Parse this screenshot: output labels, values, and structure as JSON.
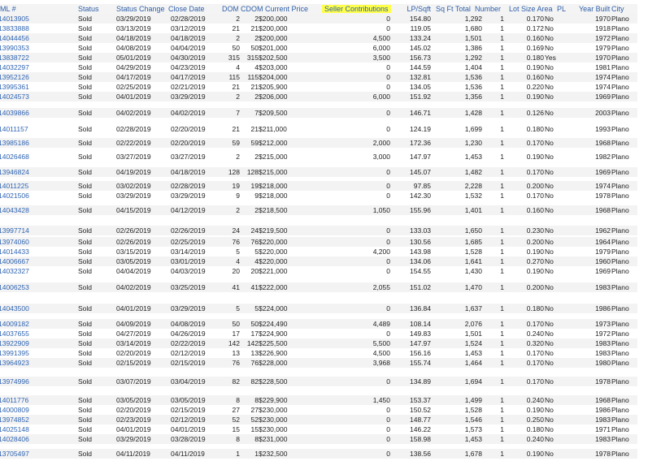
{
  "headers": {
    "mls": "ML #",
    "status": "Status",
    "change": "Status Change Date",
    "close": "Close Date",
    "dom": "DOM",
    "cdom": "CDOM",
    "price": "Current Price",
    "seller": "Seller Contributions",
    "lp": "LP/Sqft",
    "sqft": "Sq Ft Total",
    "num": "Number",
    "lot": "Lot Size Area",
    "pl": "PL",
    "yb": "Year Built",
    "city": "City"
  },
  "rows": [
    {
      "mls": "14013905",
      "status": "Sold",
      "change": "03/29/2019",
      "close": "02/28/2019",
      "dom": "2",
      "cdom": "2",
      "price": "$200,000",
      "seller": "0",
      "lp": "154.80",
      "sqft": "1,292",
      "num": "1",
      "lot": "0.170",
      "pl": "No",
      "yb": "1970",
      "city": "Plano"
    },
    {
      "mls": "13833888",
      "status": "Sold",
      "change": "03/13/2019",
      "close": "03/12/2019",
      "dom": "21",
      "cdom": "21",
      "price": "$200,000",
      "seller": "0",
      "lp": "119.05",
      "sqft": "1,680",
      "num": "1",
      "lot": "0.172",
      "pl": "No",
      "yb": "1918",
      "city": "Plano"
    },
    {
      "mls": "14044456",
      "status": "Sold",
      "change": "04/18/2019",
      "close": "04/18/2019",
      "dom": "2",
      "cdom": "2",
      "price": "$200,000",
      "seller": "4,500",
      "lp": "133.24",
      "sqft": "1,501",
      "num": "1",
      "lot": "0.160",
      "pl": "No",
      "yb": "1972",
      "city": "Plano"
    },
    {
      "mls": "13990353",
      "status": "Sold",
      "change": "04/08/2019",
      "close": "04/04/2019",
      "dom": "50",
      "cdom": "50",
      "price": "$201,000",
      "seller": "6,000",
      "lp": "145.02",
      "sqft": "1,386",
      "num": "1",
      "lot": "0.169",
      "pl": "No",
      "yb": "1979",
      "city": "Plano"
    },
    {
      "mls": "13838722",
      "status": "Sold",
      "change": "05/01/2019",
      "close": "04/30/2019",
      "dom": "315",
      "cdom": "315",
      "price": "$202,500",
      "seller": "3,500",
      "lp": "156.73",
      "sqft": "1,292",
      "num": "1",
      "lot": "0.180",
      "pl": "Yes",
      "yb": "1970",
      "city": "Plano"
    },
    {
      "mls": "14032297",
      "status": "Sold",
      "change": "04/29/2019",
      "close": "04/23/2019",
      "dom": "4",
      "cdom": "4",
      "price": "$203,000",
      "seller": "0",
      "lp": "144.59",
      "sqft": "1,404",
      "num": "1",
      "lot": "0.190",
      "pl": "No",
      "yb": "1981",
      "city": "Plano"
    },
    {
      "mls": "13952126",
      "status": "Sold",
      "change": "04/17/2019",
      "close": "04/17/2019",
      "dom": "115",
      "cdom": "115",
      "price": "$204,000",
      "seller": "0",
      "lp": "132.81",
      "sqft": "1,536",
      "num": "1",
      "lot": "0.160",
      "pl": "No",
      "yb": "1974",
      "city": "Plano"
    },
    {
      "mls": "13995361",
      "status": "Sold",
      "change": "02/25/2019",
      "close": "02/21/2019",
      "dom": "21",
      "cdom": "21",
      "price": "$205,900",
      "seller": "0",
      "lp": "134.05",
      "sqft": "1,536",
      "num": "1",
      "lot": "0.220",
      "pl": "No",
      "yb": "1974",
      "city": "Plano"
    },
    {
      "mls": "14024573",
      "status": "Sold",
      "change": "04/01/2019",
      "close": "03/29/2019",
      "dom": "2",
      "cdom": "2",
      "price": "$206,000",
      "seller": "6,000",
      "lp": "151.92",
      "sqft": "1,356",
      "num": "1",
      "lot": "0.190",
      "pl": "No",
      "yb": "1969",
      "city": "Plano"
    },
    {
      "mls": "14039866",
      "status": "Sold",
      "change": "04/02/2019",
      "close": "04/02/2019",
      "dom": "7",
      "cdom": "7",
      "price": "$209,500",
      "seller": "0",
      "lp": "146.71",
      "sqft": "1,428",
      "num": "1",
      "lot": "0.126",
      "pl": "No",
      "yb": "2003",
      "city": "Plano"
    },
    {
      "mls": "14011157",
      "status": "Sold",
      "change": "02/28/2019",
      "close": "02/20/2019",
      "dom": "21",
      "cdom": "21",
      "price": "$211,000",
      "seller": "0",
      "lp": "124.19",
      "sqft": "1,699",
      "num": "1",
      "lot": "0.180",
      "pl": "No",
      "yb": "1993",
      "city": "Plano"
    },
    {
      "mls": "13985186",
      "status": "Sold",
      "change": "02/22/2019",
      "close": "02/20/2019",
      "dom": "59",
      "cdom": "59",
      "price": "$212,000",
      "seller": "2,000",
      "lp": "172.36",
      "sqft": "1,230",
      "num": "1",
      "lot": "0.170",
      "pl": "No",
      "yb": "1968",
      "city": "Plano"
    },
    {
      "mls": "14026468",
      "status": "Sold",
      "change": "03/27/2019",
      "close": "03/27/2019",
      "dom": "2",
      "cdom": "2",
      "price": "$215,000",
      "seller": "3,000",
      "lp": "147.97",
      "sqft": "1,453",
      "num": "1",
      "lot": "0.190",
      "pl": "No",
      "yb": "1982",
      "city": "Plano"
    },
    {
      "mls": "13946824",
      "status": "Sold",
      "change": "04/19/2019",
      "close": "04/18/2019",
      "dom": "128",
      "cdom": "128",
      "price": "$215,000",
      "seller": "0",
      "lp": "145.07",
      "sqft": "1,482",
      "num": "1",
      "lot": "0.170",
      "pl": "No",
      "yb": "1969",
      "city": "Plano"
    },
    {
      "mls": "14011225",
      "status": "Sold",
      "change": "03/02/2019",
      "close": "02/28/2019",
      "dom": "19",
      "cdom": "19",
      "price": "$218,000",
      "seller": "0",
      "lp": "97.85",
      "sqft": "2,228",
      "num": "1",
      "lot": "0.200",
      "pl": "No",
      "yb": "1974",
      "city": "Plano"
    },
    {
      "mls": "14021506",
      "status": "Sold",
      "change": "03/29/2019",
      "close": "03/29/2019",
      "dom": "9",
      "cdom": "9",
      "price": "$218,000",
      "seller": "0",
      "lp": "142.30",
      "sqft": "1,532",
      "num": "1",
      "lot": "0.170",
      "pl": "No",
      "yb": "1978",
      "city": "Plano"
    },
    {
      "mls": "14043428",
      "status": "Sold",
      "change": "04/15/2019",
      "close": "04/12/2019",
      "dom": "2",
      "cdom": "2",
      "price": "$218,500",
      "seller": "1,050",
      "lp": "155.96",
      "sqft": "1,401",
      "num": "1",
      "lot": "0.160",
      "pl": "No",
      "yb": "1968",
      "city": "Plano"
    },
    {
      "mls": "13997714",
      "status": "Sold",
      "change": "02/26/2019",
      "close": "02/26/2019",
      "dom": "24",
      "cdom": "24",
      "price": "$219,500",
      "seller": "0",
      "lp": "133.03",
      "sqft": "1,650",
      "num": "1",
      "lot": "0.230",
      "pl": "No",
      "yb": "1962",
      "city": "Plano"
    },
    {
      "mls": "13974060",
      "status": "Sold",
      "change": "02/26/2019",
      "close": "02/25/2019",
      "dom": "76",
      "cdom": "76",
      "price": "$220,000",
      "seller": "0",
      "lp": "130.56",
      "sqft": "1,685",
      "num": "1",
      "lot": "0.200",
      "pl": "No",
      "yb": "1964",
      "city": "Plano"
    },
    {
      "mls": "14014433",
      "status": "Sold",
      "change": "03/15/2019",
      "close": "03/14/2019",
      "dom": "5",
      "cdom": "5",
      "price": "$220,000",
      "seller": "4,200",
      "lp": "143.98",
      "sqft": "1,528",
      "num": "1",
      "lot": "0.190",
      "pl": "No",
      "yb": "1979",
      "city": "Plano"
    },
    {
      "mls": "14006667",
      "status": "Sold",
      "change": "03/05/2019",
      "close": "03/01/2019",
      "dom": "4",
      "cdom": "4",
      "price": "$220,000",
      "seller": "0",
      "lp": "134.06",
      "sqft": "1,641",
      "num": "1",
      "lot": "0.270",
      "pl": "No",
      "yb": "1960",
      "city": "Plano"
    },
    {
      "mls": "14032327",
      "status": "Sold",
      "change": "04/04/2019",
      "close": "04/03/2019",
      "dom": "20",
      "cdom": "20",
      "price": "$221,000",
      "seller": "0",
      "lp": "154.55",
      "sqft": "1,430",
      "num": "1",
      "lot": "0.190",
      "pl": "No",
      "yb": "1969",
      "city": "Plano"
    },
    {
      "mls": "14006253",
      "status": "Sold",
      "change": "04/02/2019",
      "close": "03/25/2019",
      "dom": "41",
      "cdom": "41",
      "price": "$222,000",
      "seller": "2,055",
      "lp": "151.02",
      "sqft": "1,470",
      "num": "1",
      "lot": "0.200",
      "pl": "No",
      "yb": "1983",
      "city": "Plano"
    },
    {
      "mls": "14043500",
      "status": "Sold",
      "change": "04/01/2019",
      "close": "03/29/2019",
      "dom": "5",
      "cdom": "5",
      "price": "$224,000",
      "seller": "0",
      "lp": "136.84",
      "sqft": "1,637",
      "num": "1",
      "lot": "0.180",
      "pl": "No",
      "yb": "1986",
      "city": "Plano"
    },
    {
      "mls": "14009182",
      "status": "Sold",
      "change": "04/09/2019",
      "close": "04/08/2019",
      "dom": "50",
      "cdom": "50",
      "price": "$224,490",
      "seller": "4,489",
      "lp": "108.14",
      "sqft": "2,076",
      "num": "1",
      "lot": "0.170",
      "pl": "No",
      "yb": "1973",
      "city": "Plano"
    },
    {
      "mls": "14037655",
      "status": "Sold",
      "change": "04/27/2019",
      "close": "04/26/2019",
      "dom": "17",
      "cdom": "17",
      "price": "$224,900",
      "seller": "0",
      "lp": "149.83",
      "sqft": "1,501",
      "num": "1",
      "lot": "0.240",
      "pl": "No",
      "yb": "1972",
      "city": "Plano"
    },
    {
      "mls": "13922909",
      "status": "Sold",
      "change": "03/14/2019",
      "close": "02/22/2019",
      "dom": "142",
      "cdom": "142",
      "price": "$225,500",
      "seller": "5,500",
      "lp": "147.97",
      "sqft": "1,524",
      "num": "1",
      "lot": "0.320",
      "pl": "No",
      "yb": "1983",
      "city": "Plano"
    },
    {
      "mls": "13991395",
      "status": "Sold",
      "change": "02/20/2019",
      "close": "02/12/2019",
      "dom": "13",
      "cdom": "13",
      "price": "$226,900",
      "seller": "4,500",
      "lp": "156.16",
      "sqft": "1,453",
      "num": "1",
      "lot": "0.170",
      "pl": "No",
      "yb": "1983",
      "city": "Plano"
    },
    {
      "mls": "13964923",
      "status": "Sold",
      "change": "02/15/2019",
      "close": "02/15/2019",
      "dom": "76",
      "cdom": "76",
      "price": "$228,000",
      "seller": "3,968",
      "lp": "155.74",
      "sqft": "1,464",
      "num": "1",
      "lot": "0.170",
      "pl": "No",
      "yb": "1980",
      "city": "Plano"
    },
    {
      "mls": "13974996",
      "status": "Sold",
      "change": "03/07/2019",
      "close": "03/04/2019",
      "dom": "82",
      "cdom": "82",
      "price": "$228,500",
      "seller": "0",
      "lp": "134.89",
      "sqft": "1,694",
      "num": "1",
      "lot": "0.170",
      "pl": "No",
      "yb": "1978",
      "city": "Plano"
    },
    {
      "mls": "14011776",
      "status": "Sold",
      "change": "03/05/2019",
      "close": "03/05/2019",
      "dom": "8",
      "cdom": "8",
      "price": "$229,900",
      "seller": "1,450",
      "lp": "153.37",
      "sqft": "1,499",
      "num": "1",
      "lot": "0.240",
      "pl": "No",
      "yb": "1968",
      "city": "Plano"
    },
    {
      "mls": "14000809",
      "status": "Sold",
      "change": "02/20/2019",
      "close": "02/15/2019",
      "dom": "27",
      "cdom": "27",
      "price": "$230,000",
      "seller": "0",
      "lp": "150.52",
      "sqft": "1,528",
      "num": "1",
      "lot": "0.190",
      "pl": "No",
      "yb": "1986",
      "city": "Plano"
    },
    {
      "mls": "13974852",
      "status": "Sold",
      "change": "02/23/2019",
      "close": "02/12/2019",
      "dom": "52",
      "cdom": "52",
      "price": "$230,000",
      "seller": "0",
      "lp": "148.77",
      "sqft": "1,546",
      "num": "1",
      "lot": "0.250",
      "pl": "No",
      "yb": "1983",
      "city": "Plano"
    },
    {
      "mls": "14025148",
      "status": "Sold",
      "change": "04/01/2019",
      "close": "04/01/2019",
      "dom": "15",
      "cdom": "15",
      "price": "$230,000",
      "seller": "0",
      "lp": "146.22",
      "sqft": "1,573",
      "num": "1",
      "lot": "0.180",
      "pl": "No",
      "yb": "1971",
      "city": "Plano"
    },
    {
      "mls": "14028406",
      "status": "Sold",
      "change": "03/29/2019",
      "close": "03/28/2019",
      "dom": "8",
      "cdom": "8",
      "price": "$231,000",
      "seller": "0",
      "lp": "158.98",
      "sqft": "1,453",
      "num": "1",
      "lot": "0.240",
      "pl": "No",
      "yb": "1983",
      "city": "Plano"
    },
    {
      "mls": "13705497",
      "status": "Sold",
      "change": "04/11/2019",
      "close": "04/11/2019",
      "dom": "1",
      "cdom": "1",
      "price": "$232,500",
      "seller": "0",
      "lp": "138.56",
      "sqft": "1,678",
      "num": "1",
      "lot": "0.190",
      "pl": "No",
      "yb": "1978",
      "city": "Plano"
    }
  ]
}
